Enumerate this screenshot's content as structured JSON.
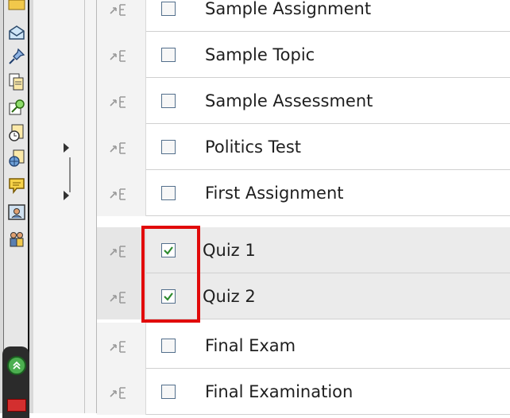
{
  "toolbar": {
    "icons": [
      "envelope-icon",
      "pushpin-icon",
      "documents-icon",
      "search-key-icon",
      "clock-icon",
      "globe-icon",
      "chat-bubble-icon",
      "id-card-icon",
      "people-icon"
    ],
    "bottom": [
      "expand-up-icon",
      "red-book-icon"
    ]
  },
  "rows": [
    {
      "label": "Sample Assignment",
      "checked": false
    },
    {
      "label": "Sample Topic",
      "checked": false
    },
    {
      "label": "Sample Assessment",
      "checked": false
    },
    {
      "label": "Politics Test",
      "checked": false
    },
    {
      "label": "First Assignment",
      "checked": false
    },
    {
      "label": "Quiz 1",
      "checked": true
    },
    {
      "label": "Quiz 2",
      "checked": true
    },
    {
      "label": "Final Exam",
      "checked": false
    },
    {
      "label": "Final Examination",
      "checked": false
    }
  ],
  "colors": {
    "highlight": "#e10a0a",
    "check": "#2e8b2e"
  }
}
